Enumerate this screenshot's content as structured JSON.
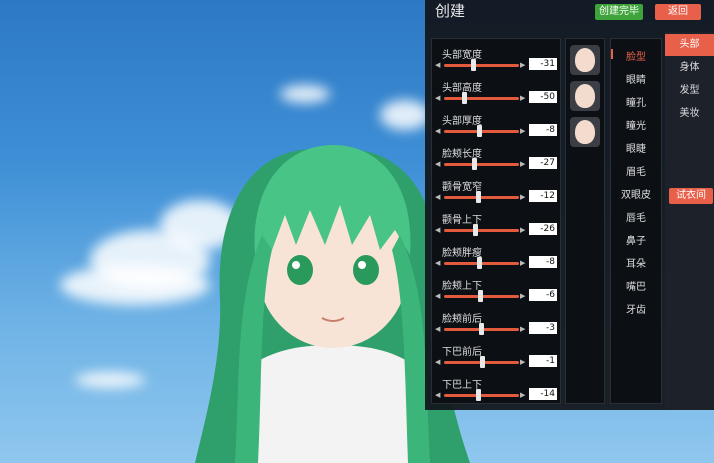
{
  "panel": {
    "title": "创建",
    "create_done_label": "创建完毕",
    "back_label": "返回",
    "try_on_label": "试衣间"
  },
  "sliders": [
    {
      "label": "头部宽度",
      "value": "-31",
      "level": 0.38
    },
    {
      "label": "头部高度",
      "value": "-50",
      "level": 0.27
    },
    {
      "label": "头部厚度",
      "value": "-8",
      "level": 0.47
    },
    {
      "label": "脸颊长度",
      "value": "-27",
      "level": 0.4
    },
    {
      "label": "颧骨宽窄",
      "value": "-12",
      "level": 0.45
    },
    {
      "label": "颧骨上下",
      "value": "-26",
      "level": 0.41
    },
    {
      "label": "脸颊胖瘦",
      "value": "-8",
      "level": 0.47
    },
    {
      "label": "脸颊上下",
      "value": "-6",
      "level": 0.48
    },
    {
      "label": "脸颊前后",
      "value": "-3",
      "level": 0.49
    },
    {
      "label": "下巴前后",
      "value": "-1",
      "level": 0.5
    },
    {
      "label": "下巴上下",
      "value": "-14",
      "level": 0.45
    }
  ],
  "face_presets": [
    "face-preset-1",
    "face-preset-2",
    "face-preset-3"
  ],
  "categories": [
    "脸型",
    "眼睛",
    "瞳孔",
    "瞳光",
    "眼睫",
    "眉毛",
    "双眼皮",
    "唇毛",
    "鼻子",
    "耳朵",
    "嘴巴",
    "牙齿"
  ],
  "active_category": "脸型",
  "side_tabs": [
    "头部",
    "身体",
    "发型",
    "美妆"
  ],
  "active_side_tab": "头部",
  "colors": {
    "accent": "#e8604a",
    "create_green": "#3ea33a",
    "hair": "#4fc98a"
  }
}
